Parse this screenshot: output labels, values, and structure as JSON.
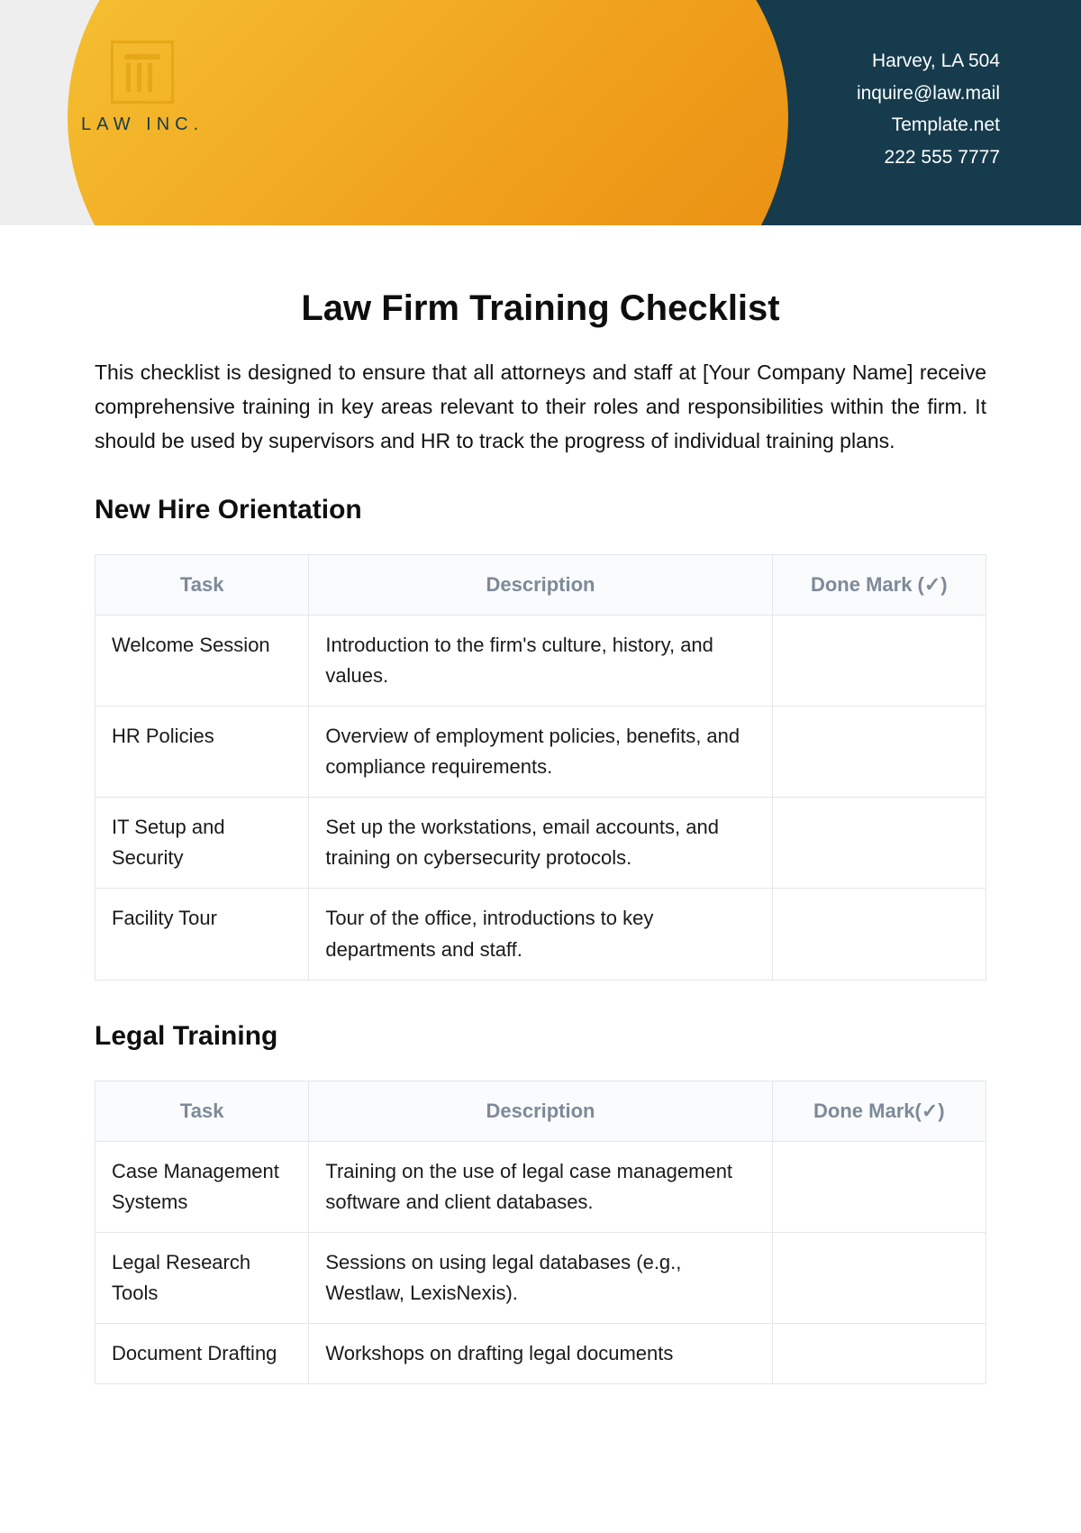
{
  "header": {
    "logo_text": "LAW INC.",
    "contact": {
      "address": "Harvey, LA 504",
      "email": "inquire@law.mail",
      "site": "Template.net",
      "phone": "222 555 7777"
    }
  },
  "doc": {
    "title": "Law Firm Training Checklist",
    "intro": "This checklist is designed to ensure that all attorneys and staff at [Your Company Name] receive comprehensive training in key areas relevant to their roles and responsibilities within the firm. It should be used by supervisors and HR to track the progress of individual training plans."
  },
  "sections": [
    {
      "heading": "New Hire Orientation",
      "columns": {
        "task": "Task",
        "description": "Description",
        "done": "Done Mark (✓)"
      },
      "rows": [
        {
          "task": "Welcome Session",
          "description": "Introduction to the firm's culture, history, and values.",
          "done": ""
        },
        {
          "task": "HR Policies",
          "description": "Overview of employment policies, benefits, and compliance requirements.",
          "done": ""
        },
        {
          "task": "IT Setup and Security",
          "description": "Set up the workstations, email accounts, and training on cybersecurity protocols.",
          "done": ""
        },
        {
          "task": "Facility Tour",
          "description": "Tour of the office, introductions to key departments and staff.",
          "done": ""
        }
      ]
    },
    {
      "heading": "Legal Training",
      "columns": {
        "task": "Task",
        "description": "Description",
        "done": "Done Mark(✓)"
      },
      "rows": [
        {
          "task": "Case Management Systems",
          "description": "Training on the use of legal case management software and client databases.",
          "done": ""
        },
        {
          "task": "Legal Research Tools",
          "description": "Sessions on using legal databases (e.g., Westlaw, LexisNexis).",
          "done": ""
        },
        {
          "task": "Document Drafting",
          "description": "Workshops on drafting legal documents",
          "done": ""
        }
      ]
    }
  ]
}
